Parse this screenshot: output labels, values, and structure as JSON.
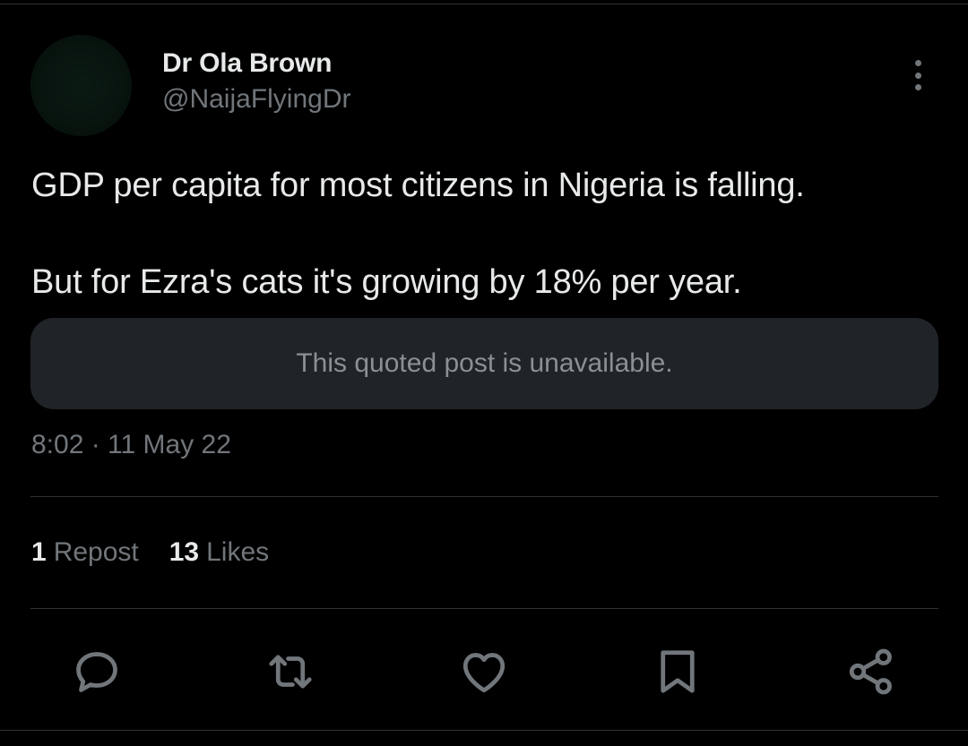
{
  "author": {
    "display_name": "Dr Ola Brown",
    "handle": "@NaijaFlyingDr"
  },
  "tweet": {
    "paragraphs": [
      "GDP per capita for most citizens in Nigeria is falling.",
      "But for Ezra's cats it's growing by 18% per year."
    ],
    "quote_unavailable_text": "This quoted post is unavailable.",
    "timestamp": "8:02 · 11 May 22"
  },
  "stats": {
    "reposts_count": "1",
    "reposts_label": "Repost",
    "likes_count": "13",
    "likes_label": "Likes"
  },
  "actions": {
    "icons": [
      "reply-icon",
      "repost-icon",
      "like-icon",
      "bookmark-icon",
      "share-icon"
    ]
  },
  "colors": {
    "background": "#000000",
    "primary_text": "#e7e9ea",
    "secondary_text": "#71767b",
    "quote_box_bg": "#202327",
    "divider": "#2f3336"
  }
}
